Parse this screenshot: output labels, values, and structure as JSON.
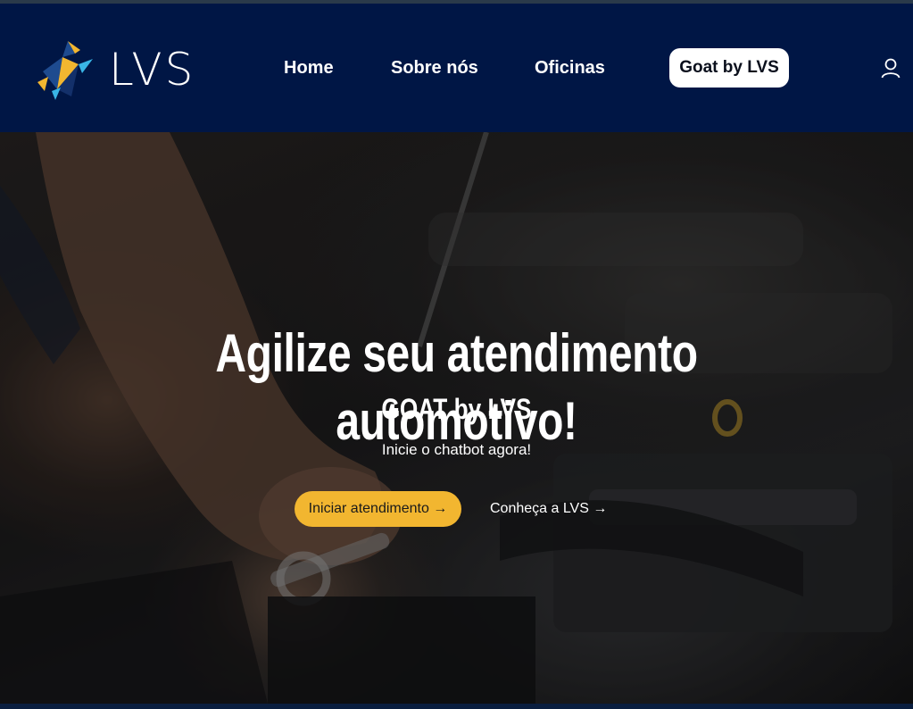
{
  "header": {
    "logo_text": "LVS",
    "nav": {
      "home": "Home",
      "about": "Sobre nós",
      "workshops": "Oficinas",
      "goat": "Goat by LVS"
    },
    "user_icon": "user-icon"
  },
  "hero": {
    "title": "Agilize seu atendimento automotivo!",
    "subtitle": "GOAT by LVS",
    "text": "Inicie o chatbot agora!",
    "primary_button": "Iniciar atendimento →",
    "secondary_link": "Conheça a LVS →"
  },
  "colors": {
    "header_bg": "#001645",
    "accent": "#f2b630",
    "logo_blue": "#1e4b8f",
    "logo_yellow": "#f2b630",
    "logo_cyan": "#39b5e6"
  }
}
